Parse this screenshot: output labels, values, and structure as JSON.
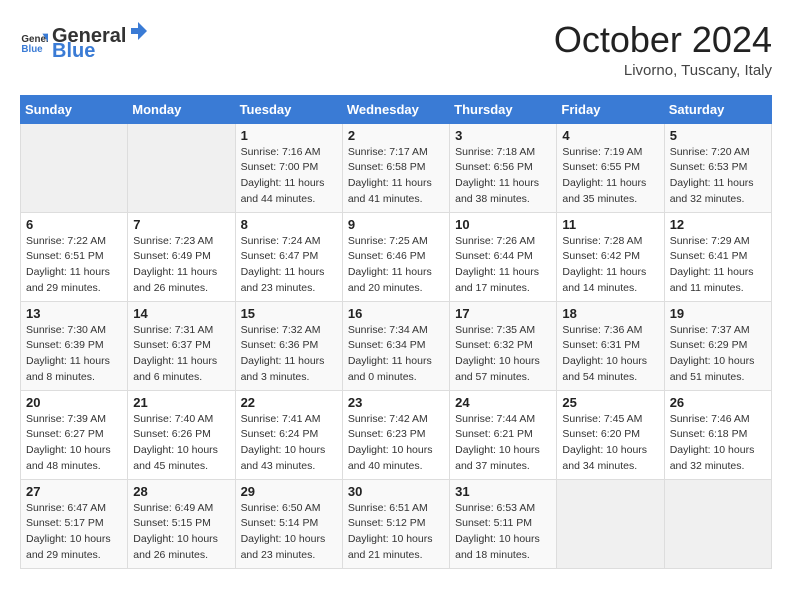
{
  "header": {
    "logo": {
      "general": "General",
      "blue": "Blue"
    },
    "title": "October 2024",
    "location": "Livorno, Tuscany, Italy"
  },
  "weekdays": [
    "Sunday",
    "Monday",
    "Tuesday",
    "Wednesday",
    "Thursday",
    "Friday",
    "Saturday"
  ],
  "weeks": [
    [
      {
        "day": "",
        "empty": true
      },
      {
        "day": "",
        "empty": true
      },
      {
        "day": "1",
        "sunrise": "7:16 AM",
        "sunset": "7:00 PM",
        "daylight": "11 hours and 44 minutes."
      },
      {
        "day": "2",
        "sunrise": "7:17 AM",
        "sunset": "6:58 PM",
        "daylight": "11 hours and 41 minutes."
      },
      {
        "day": "3",
        "sunrise": "7:18 AM",
        "sunset": "6:56 PM",
        "daylight": "11 hours and 38 minutes."
      },
      {
        "day": "4",
        "sunrise": "7:19 AM",
        "sunset": "6:55 PM",
        "daylight": "11 hours and 35 minutes."
      },
      {
        "day": "5",
        "sunrise": "7:20 AM",
        "sunset": "6:53 PM",
        "daylight": "11 hours and 32 minutes."
      }
    ],
    [
      {
        "day": "6",
        "sunrise": "7:22 AM",
        "sunset": "6:51 PM",
        "daylight": "11 hours and 29 minutes."
      },
      {
        "day": "7",
        "sunrise": "7:23 AM",
        "sunset": "6:49 PM",
        "daylight": "11 hours and 26 minutes."
      },
      {
        "day": "8",
        "sunrise": "7:24 AM",
        "sunset": "6:47 PM",
        "daylight": "11 hours and 23 minutes."
      },
      {
        "day": "9",
        "sunrise": "7:25 AM",
        "sunset": "6:46 PM",
        "daylight": "11 hours and 20 minutes."
      },
      {
        "day": "10",
        "sunrise": "7:26 AM",
        "sunset": "6:44 PM",
        "daylight": "11 hours and 17 minutes."
      },
      {
        "day": "11",
        "sunrise": "7:28 AM",
        "sunset": "6:42 PM",
        "daylight": "11 hours and 14 minutes."
      },
      {
        "day": "12",
        "sunrise": "7:29 AM",
        "sunset": "6:41 PM",
        "daylight": "11 hours and 11 minutes."
      }
    ],
    [
      {
        "day": "13",
        "sunrise": "7:30 AM",
        "sunset": "6:39 PM",
        "daylight": "11 hours and 8 minutes."
      },
      {
        "day": "14",
        "sunrise": "7:31 AM",
        "sunset": "6:37 PM",
        "daylight": "11 hours and 6 minutes."
      },
      {
        "day": "15",
        "sunrise": "7:32 AM",
        "sunset": "6:36 PM",
        "daylight": "11 hours and 3 minutes."
      },
      {
        "day": "16",
        "sunrise": "7:34 AM",
        "sunset": "6:34 PM",
        "daylight": "11 hours and 0 minutes."
      },
      {
        "day": "17",
        "sunrise": "7:35 AM",
        "sunset": "6:32 PM",
        "daylight": "10 hours and 57 minutes."
      },
      {
        "day": "18",
        "sunrise": "7:36 AM",
        "sunset": "6:31 PM",
        "daylight": "10 hours and 54 minutes."
      },
      {
        "day": "19",
        "sunrise": "7:37 AM",
        "sunset": "6:29 PM",
        "daylight": "10 hours and 51 minutes."
      }
    ],
    [
      {
        "day": "20",
        "sunrise": "7:39 AM",
        "sunset": "6:27 PM",
        "daylight": "10 hours and 48 minutes."
      },
      {
        "day": "21",
        "sunrise": "7:40 AM",
        "sunset": "6:26 PM",
        "daylight": "10 hours and 45 minutes."
      },
      {
        "day": "22",
        "sunrise": "7:41 AM",
        "sunset": "6:24 PM",
        "daylight": "10 hours and 43 minutes."
      },
      {
        "day": "23",
        "sunrise": "7:42 AM",
        "sunset": "6:23 PM",
        "daylight": "10 hours and 40 minutes."
      },
      {
        "day": "24",
        "sunrise": "7:44 AM",
        "sunset": "6:21 PM",
        "daylight": "10 hours and 37 minutes."
      },
      {
        "day": "25",
        "sunrise": "7:45 AM",
        "sunset": "6:20 PM",
        "daylight": "10 hours and 34 minutes."
      },
      {
        "day": "26",
        "sunrise": "7:46 AM",
        "sunset": "6:18 PM",
        "daylight": "10 hours and 32 minutes."
      }
    ],
    [
      {
        "day": "27",
        "sunrise": "6:47 AM",
        "sunset": "5:17 PM",
        "daylight": "10 hours and 29 minutes."
      },
      {
        "day": "28",
        "sunrise": "6:49 AM",
        "sunset": "5:15 PM",
        "daylight": "10 hours and 26 minutes."
      },
      {
        "day": "29",
        "sunrise": "6:50 AM",
        "sunset": "5:14 PM",
        "daylight": "10 hours and 23 minutes."
      },
      {
        "day": "30",
        "sunrise": "6:51 AM",
        "sunset": "5:12 PM",
        "daylight": "10 hours and 21 minutes."
      },
      {
        "day": "31",
        "sunrise": "6:53 AM",
        "sunset": "5:11 PM",
        "daylight": "10 hours and 18 minutes."
      },
      {
        "day": "",
        "empty": true
      },
      {
        "day": "",
        "empty": true
      }
    ]
  ]
}
